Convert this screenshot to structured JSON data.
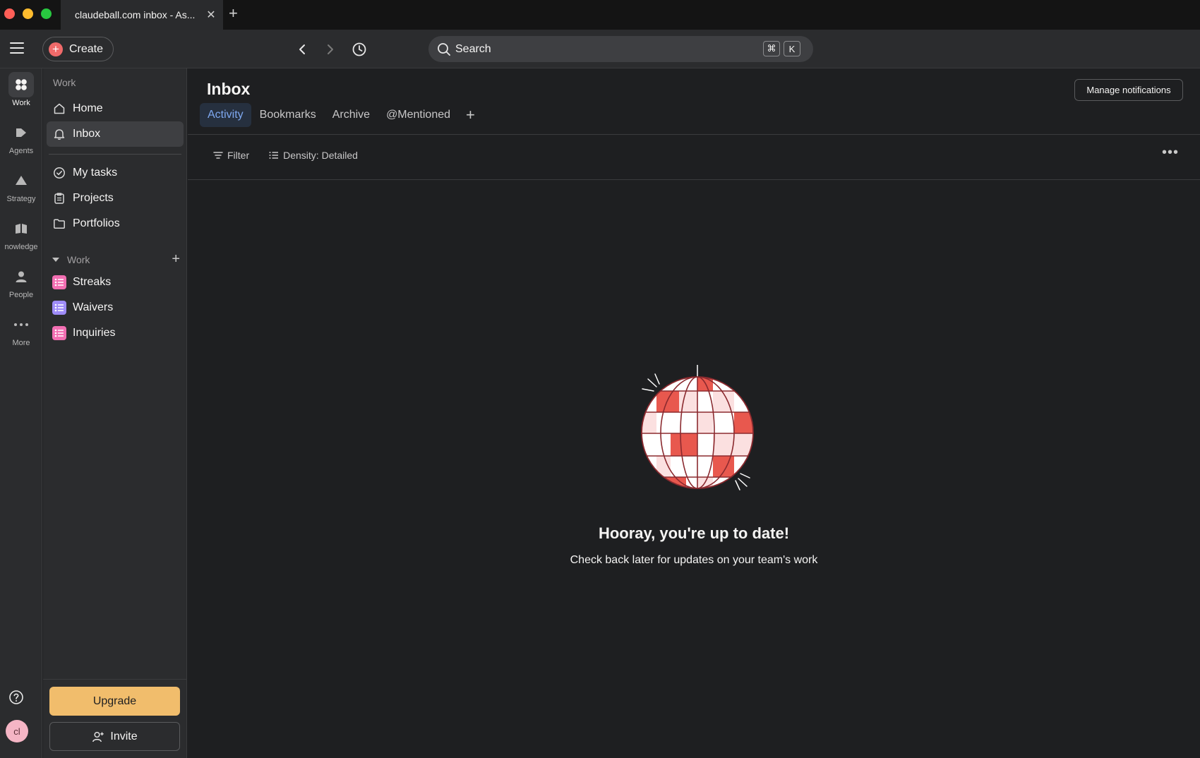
{
  "browser": {
    "tab_title": "claudeball.com inbox - As...",
    "traffic_colors": [
      "#ff5f57",
      "#febc2e",
      "#28c840"
    ]
  },
  "topbar": {
    "create_label": "Create",
    "search_placeholder": "Search",
    "shortcut_keys": [
      "⌘",
      "K"
    ]
  },
  "rail": {
    "items": [
      {
        "label": "Work",
        "icon": "work-icon"
      },
      {
        "label": "Agents",
        "icon": "agents-icon"
      },
      {
        "label": "Strategy",
        "icon": "strategy-icon"
      },
      {
        "label": "nowledge",
        "icon": "knowledge-icon"
      },
      {
        "label": "People",
        "icon": "people-icon"
      },
      {
        "label": "More",
        "icon": "more-icon"
      }
    ],
    "avatar_initials": "cl"
  },
  "sidebar": {
    "heading": "Work",
    "nav": [
      {
        "label": "Home",
        "icon": "home-icon"
      },
      {
        "label": "Inbox",
        "icon": "bell-icon"
      }
    ],
    "work_nav": [
      {
        "label": "My tasks",
        "icon": "check-circle-icon"
      },
      {
        "label": "Projects",
        "icon": "clipboard-icon"
      },
      {
        "label": "Portfolios",
        "icon": "folder-icon"
      }
    ],
    "section_label": "Work",
    "projects": [
      {
        "label": "Streaks",
        "color": "#f26fb2"
      },
      {
        "label": "Waivers",
        "color": "#9e8cf8"
      },
      {
        "label": "Inquiries",
        "color": "#f26fb2"
      }
    ],
    "upgrade_label": "Upgrade",
    "invite_label": "Invite"
  },
  "main": {
    "title": "Inbox",
    "manage_label": "Manage notifications",
    "tabs": [
      "Activity",
      "Bookmarks",
      "Archive",
      "@Mentioned"
    ],
    "filter_label": "Filter",
    "density_label": "Density: Detailed",
    "empty_title": "Hooray, you're up to date!",
    "empty_subtitle": "Check back later for updates on your team's work"
  },
  "colors": {
    "accent_tab": "#7ea8f0",
    "upgrade": "#f1bd6c",
    "create_plus": "#f06a6a",
    "disco_red": "#e8584e"
  }
}
